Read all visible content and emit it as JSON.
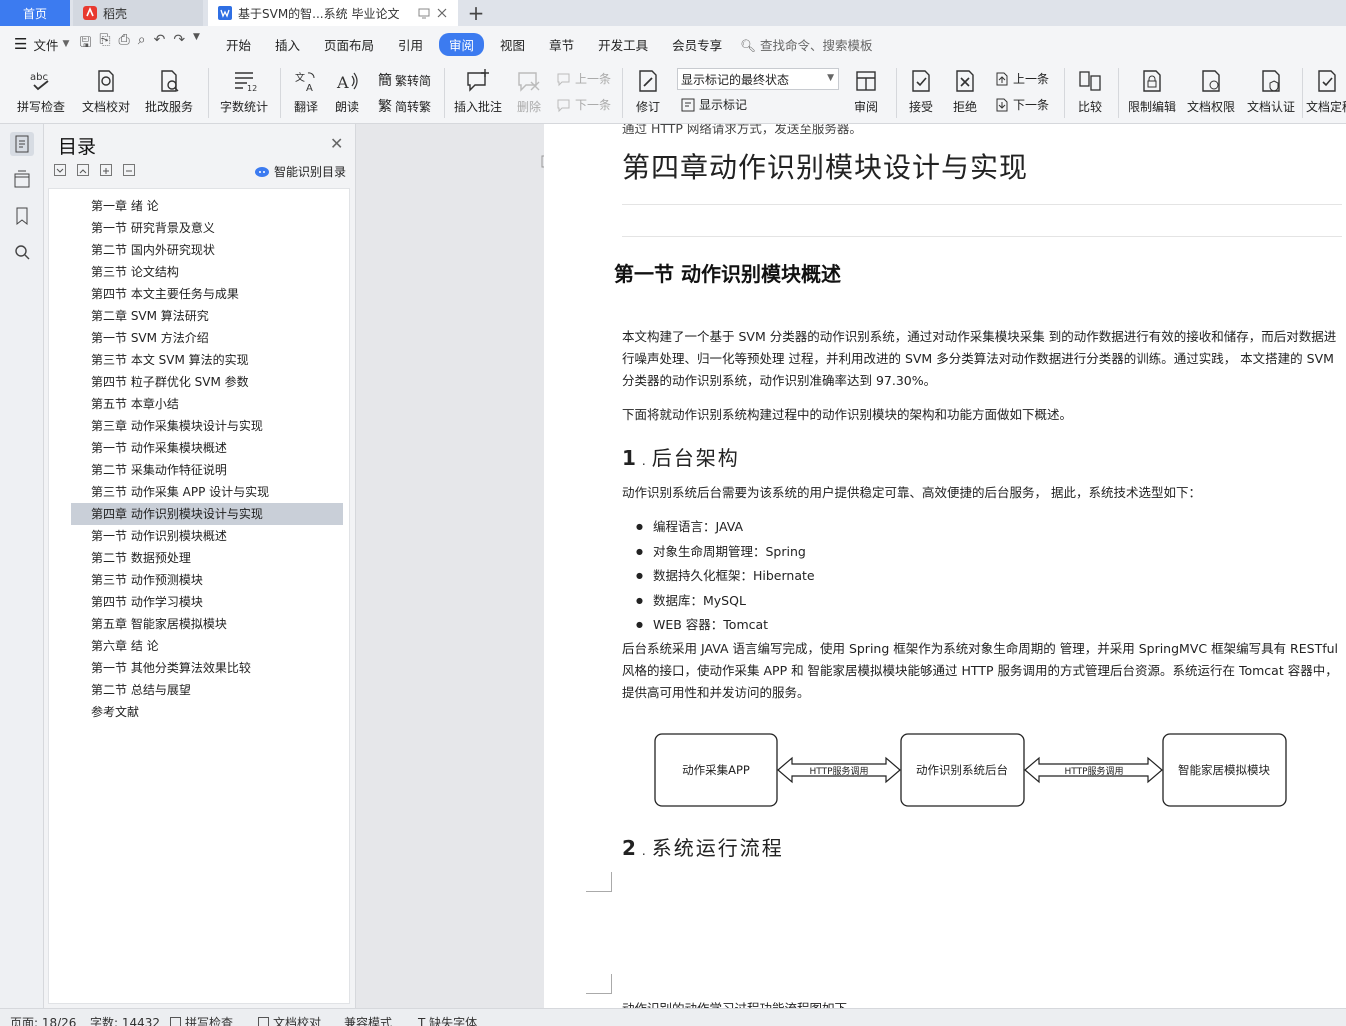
{
  "tabs": {
    "home": "首页",
    "daoke": "稻壳",
    "doc": "基于SVM的智...系统 毕业论文"
  },
  "menu": {
    "file": "文件",
    "items": [
      "开始",
      "插入",
      "页面布局",
      "引用",
      "审阅",
      "视图",
      "章节",
      "开发工具",
      "会员专享"
    ],
    "active": "审阅",
    "search": "查找命令、搜索模板"
  },
  "ribbon": {
    "spell": "拼写检查",
    "proof": "文档校对",
    "batch": "批改服务",
    "wordcount": "字数统计",
    "translate": "翻译",
    "read": "朗读",
    "t2s": "繁转简",
    "s2t": "简转繁",
    "insert_comment": "插入批注",
    "delete": "删除",
    "prev_comment": "上一条",
    "next_comment": "下一条",
    "revise": "修订",
    "show_state": "显示标记的最终状态",
    "show_marks": "显示标记",
    "review": "审阅",
    "accept": "接受",
    "reject": "拒绝",
    "prev": "上一条",
    "next": "下一条",
    "compare": "比较",
    "restrict": "限制编辑",
    "rights": "文档权限",
    "certify": "文档认证",
    "finalize": "文档定稿"
  },
  "toc": {
    "title": "目录",
    "smart": "智能识别目录",
    "items": [
      "第一章 绪 论",
      "第一节 研究背景及意义",
      "第二节 国内外研究现状",
      "第三节 论文结构",
      "第四节 本文主要任务与成果",
      "第二章 SVM 算法研究",
      "第一节 SVM 方法介绍",
      "第三节 本文 SVM 算法的实现",
      "第四节 粒子群优化 SVM 参数",
      "第五节 本章小结",
      "第三章 动作采集模块设计与实现",
      "第一节 动作采集模块概述",
      "第二节 采集动作特征说明",
      "第三节 动作采集 APP 设计与实现",
      "第四章 动作识别模块设计与实现",
      "第一节 动作识别模块概述",
      "第二节 数据预处理",
      "第三节 动作预测模块",
      "第四节 动作学习模块",
      "第五章 智能家居模拟模块",
      "第六章 结 论",
      "第一节 其他分类算法效果比较",
      "第二节 总结与展望",
      "参考文献"
    ],
    "selected": 14
  },
  "doc": {
    "top_cut": "通过 HTTP 网络请求方式，发送至服务器。",
    "chapter": "第四章动作识别模块设计与实现",
    "section": "第一节 动作识别模块概述",
    "p1": "本文构建了一个基于 SVM 分类器的动作识别系统，通过对动作采集模块采集 到的动作数据进行有效的接收和储存，而后对数据进行噪声处理、归一化等预处理 过程，并利用改进的 SVM 多分类算法对动作数据进行分类器的训练。通过实践， 本文搭建的 SVM 分类器的动作识别系统，动作识别准确率达到 97.30%。",
    "p2": "下面将就动作识别系统构建过程中的动作识别模块的架构和功能方面做如下概述。",
    "h1_num": "1",
    "h1": "后台架构",
    "p3": "动作识别系统后台需要为该系统的用户提供稳定可靠、高效便捷的后台服务， 据此，系统技术选型如下：",
    "bullets": [
      "编程语言：JAVA",
      "对象生命周期管理：Spring",
      "数据持久化框架：Hibernate",
      "数据库：MySQL",
      "WEB 容器：Tomcat"
    ],
    "p4": "后台系统采用 JAVA 语言编写完成，使用 Spring 框架作为系统对象生命周期的 管理，并采用 SpringMVC 框架编写具有 RESTful 风格的接口，使动作采集 APP 和 智能家居模拟模块能够通过 HTTP 服务调用的方式管理后台资源。系统运行在 Tomcat 容器中，提供高可用性和并发访问的服务。",
    "diagram": {
      "box1": "动作采集APP",
      "arrow1": "HTTP服务调用",
      "box2": "动作识别系统后台",
      "arrow2": "HTTP服务调用",
      "box3": "智能家居模拟模块"
    },
    "h2_num": "2",
    "h2": "系统运行流程",
    "page2_cut": "动作识别的动作学习过程功能流程图如下"
  },
  "status": {
    "page": "页面: 18/26",
    "words": "字数: 14432",
    "spell": "拼写检查",
    "proof": "文档校对",
    "compat": "兼容模式",
    "missing_font": "缺失字体"
  }
}
